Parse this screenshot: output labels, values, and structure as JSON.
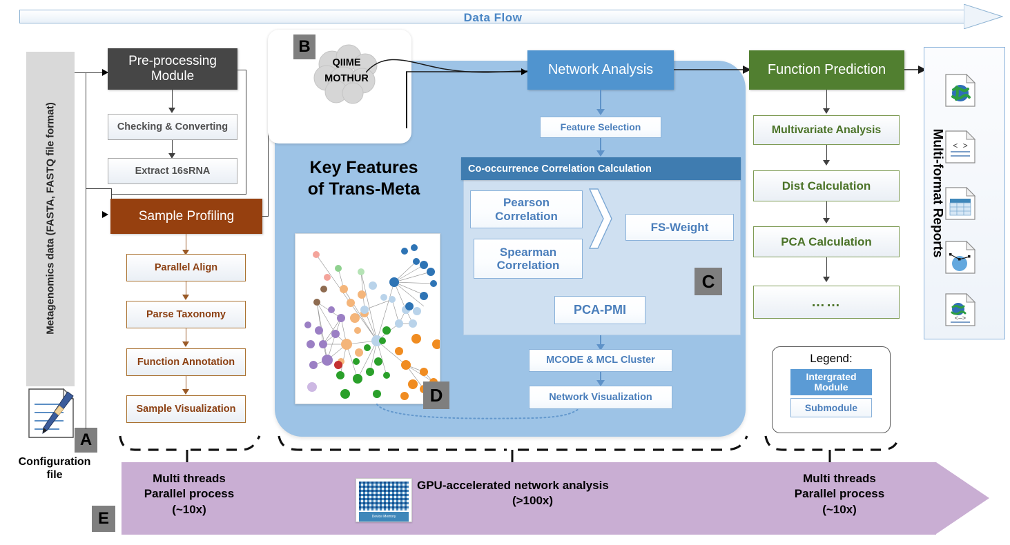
{
  "dataflow": {
    "label": "Data   Flow",
    "accent": "#4a86c5"
  },
  "input": {
    "bar_label": "Metagenomics data (FASTA, FASTQ file format)",
    "config_label": "Configuration\nfile",
    "config_label_line1": "Configuration",
    "config_label_line2": "file",
    "tag_a": "A"
  },
  "preprocessing": {
    "title": "Pre-processing\nModule",
    "title_line1": "Pre-processing",
    "title_line2": "Module",
    "color": "#464646",
    "steps": [
      {
        "label": "Checking & Converting"
      },
      {
        "label": "Extract 16sRNA"
      }
    ]
  },
  "sample_profiling": {
    "title": "Sample Profiling",
    "color": "#96400f",
    "steps": [
      {
        "label": "Parallel Align"
      },
      {
        "label": "Parse Taxonomy"
      },
      {
        "label": "Function Annotation"
      },
      {
        "label": "Sample Visualization"
      }
    ]
  },
  "external_tools": {
    "tag_b": "B",
    "cloud_line1": "QIIME",
    "cloud_line2": "MOTHUR"
  },
  "key_features": {
    "title_line1": "Key Features",
    "title_line2": "of Trans-Meta",
    "panel_color": "#9dc3e6",
    "tag_d": "D"
  },
  "network_analysis": {
    "title": "Network Analysis",
    "color": "#5094cf",
    "feature_selection": "Feature Selection",
    "cooccurrence": {
      "header": "Co-occurrence Correlation Calculation",
      "header_color": "#3f7cb0",
      "tag_c": "C",
      "methods": [
        {
          "label_line1": "Pearson",
          "label_line2": "Correlation"
        },
        {
          "label_line1": "Spearman",
          "label_line2": "Correlation"
        }
      ],
      "output": "FS-Weight",
      "pcapmi": "PCA-PMI"
    },
    "post_steps": [
      {
        "label": "MCODE & MCL Cluster"
      },
      {
        "label": "Network Visualization"
      }
    ]
  },
  "function_prediction": {
    "title": "Function Prediction",
    "color": "#517f30",
    "steps": [
      {
        "label": "Multivariate Analysis"
      },
      {
        "label": "Dist Calculation"
      },
      {
        "label": "PCA Calculation"
      },
      {
        "label": "……"
      }
    ]
  },
  "reports": {
    "label": "Multi-format Reports",
    "icons": [
      "globe-document-icon",
      "code-document-icon",
      "table-document-icon",
      "chart-document-icon",
      "web-document-icon"
    ]
  },
  "legend": {
    "title": "Legend:",
    "integrated_line1": "Intergrated",
    "integrated_line2": "Module",
    "integrated_color": "#5b9bd5",
    "submodule": "Submodule"
  },
  "performance": {
    "tag_e": "E",
    "arrow_color": "#c9aed3",
    "left": {
      "line1": "Multi threads",
      "line2": "Parallel process",
      "line3": "(~10x)"
    },
    "center": {
      "line1": "GPU-accelerated network analysis",
      "line2": "(>100x)",
      "chip_label": "Device Memory"
    },
    "right": {
      "line1": "Multi threads",
      "line2": "Parallel process",
      "line3": "(~10x)"
    }
  }
}
